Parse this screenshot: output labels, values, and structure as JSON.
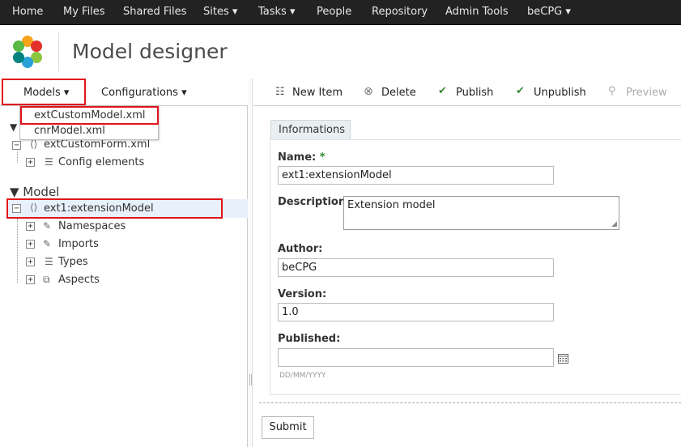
{
  "topnav": {
    "items": [
      "Home",
      "My Files",
      "Shared Files",
      "Sites ▾",
      "Tasks ▾",
      "People",
      "Repository",
      "Admin Tools",
      "beCPG ▾"
    ]
  },
  "header": {
    "title": "Model designer"
  },
  "left_toolbar": {
    "models": "Models ▾",
    "configurations": "Configurations ▾"
  },
  "dropdown": {
    "items": [
      "extCustomModel.xml",
      "cnrModel.xml"
    ]
  },
  "tree": {
    "form_node": "extCustomForm.xml",
    "config_elements": "Config elements",
    "model_header": "▼ Model",
    "model_node": "ext1:extensionModel",
    "children": [
      "Namespaces",
      "Imports",
      "Types",
      "Aspects"
    ]
  },
  "right_toolbar": {
    "new_item": "New Item",
    "delete": "Delete",
    "publish": "Publish",
    "unpublish": "Unpublish",
    "preview": "Preview"
  },
  "form": {
    "tab": "Informations",
    "name_label": "Name:",
    "name_required": "*",
    "name_value": "ext1:extensionModel",
    "description_label": "Description:",
    "description_value": "Extension model",
    "author_label": "Author:",
    "author_value": "beCPG",
    "version_label": "Version:",
    "version_value": "1.0",
    "published_label": "Published:",
    "published_value": "",
    "date_hint": "DD/MM/YYYY",
    "submit": "Submit"
  },
  "colors": {
    "highlight_red": "#e0141e",
    "nav_bg": "#222222",
    "selected_row": "#e8f0fb"
  }
}
